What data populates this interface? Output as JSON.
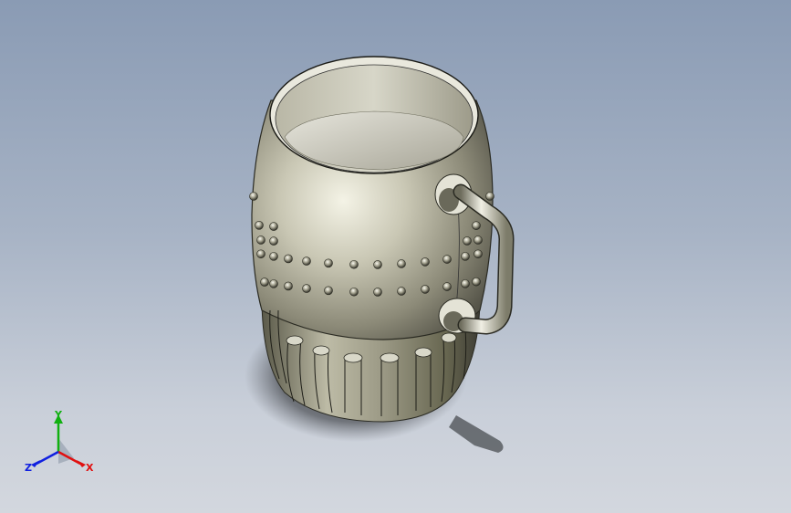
{
  "viewport": {
    "background_top": "#8a9bb4",
    "background_bottom": "#d3d7de"
  },
  "model": {
    "body_color": "#8c8a78",
    "highlight_color": "#f4f3e6",
    "shadow_color": "#3d3c34",
    "rivet_rows": 2,
    "flute_count": 8
  },
  "triad": {
    "x_label": "X",
    "y_label": "Y",
    "z_label": "Z",
    "x_color": "#e01010",
    "y_color": "#10b010",
    "z_color": "#1020e0"
  }
}
